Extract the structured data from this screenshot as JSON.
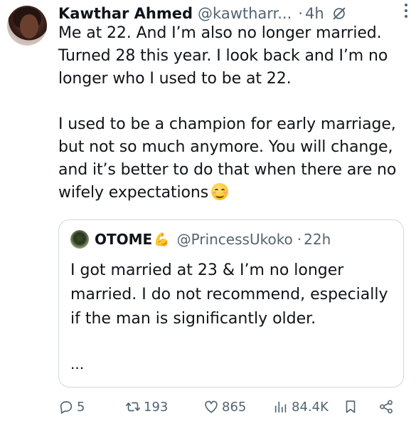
{
  "tweet": {
    "author_name": "Kawthar Ahmed",
    "author_handle": "@kawtharr...",
    "separator": "·",
    "time": "4h",
    "text": "Me at 22. And I’m also no longer married. Turned 28 this year. I look back and I’m no longer who I used to be at 22.\n\nI used to be a champion for early marriage, but not so much anymore. You will change, and it’s better to do that when there are no wifely expectations",
    "trailing_emoji": "smiling-face-icon"
  },
  "quoted_tweet": {
    "author_name": "OTOME",
    "author_emoji": "💪",
    "author_handle": "@PrincessUkoko",
    "separator": "·",
    "time": "22h",
    "text": "I got married at 23 & I’m no longer married. I do not recommend, especially if the man is significantly older.",
    "ellipsis": "..."
  },
  "actions": {
    "replies": "5",
    "reposts": "193",
    "likes": "865",
    "views": "84.4K"
  },
  "colors": {
    "text": "#0f1419",
    "secondary": "#536471",
    "border": "#cfd9de",
    "emoji_gold": "#f7b500"
  }
}
